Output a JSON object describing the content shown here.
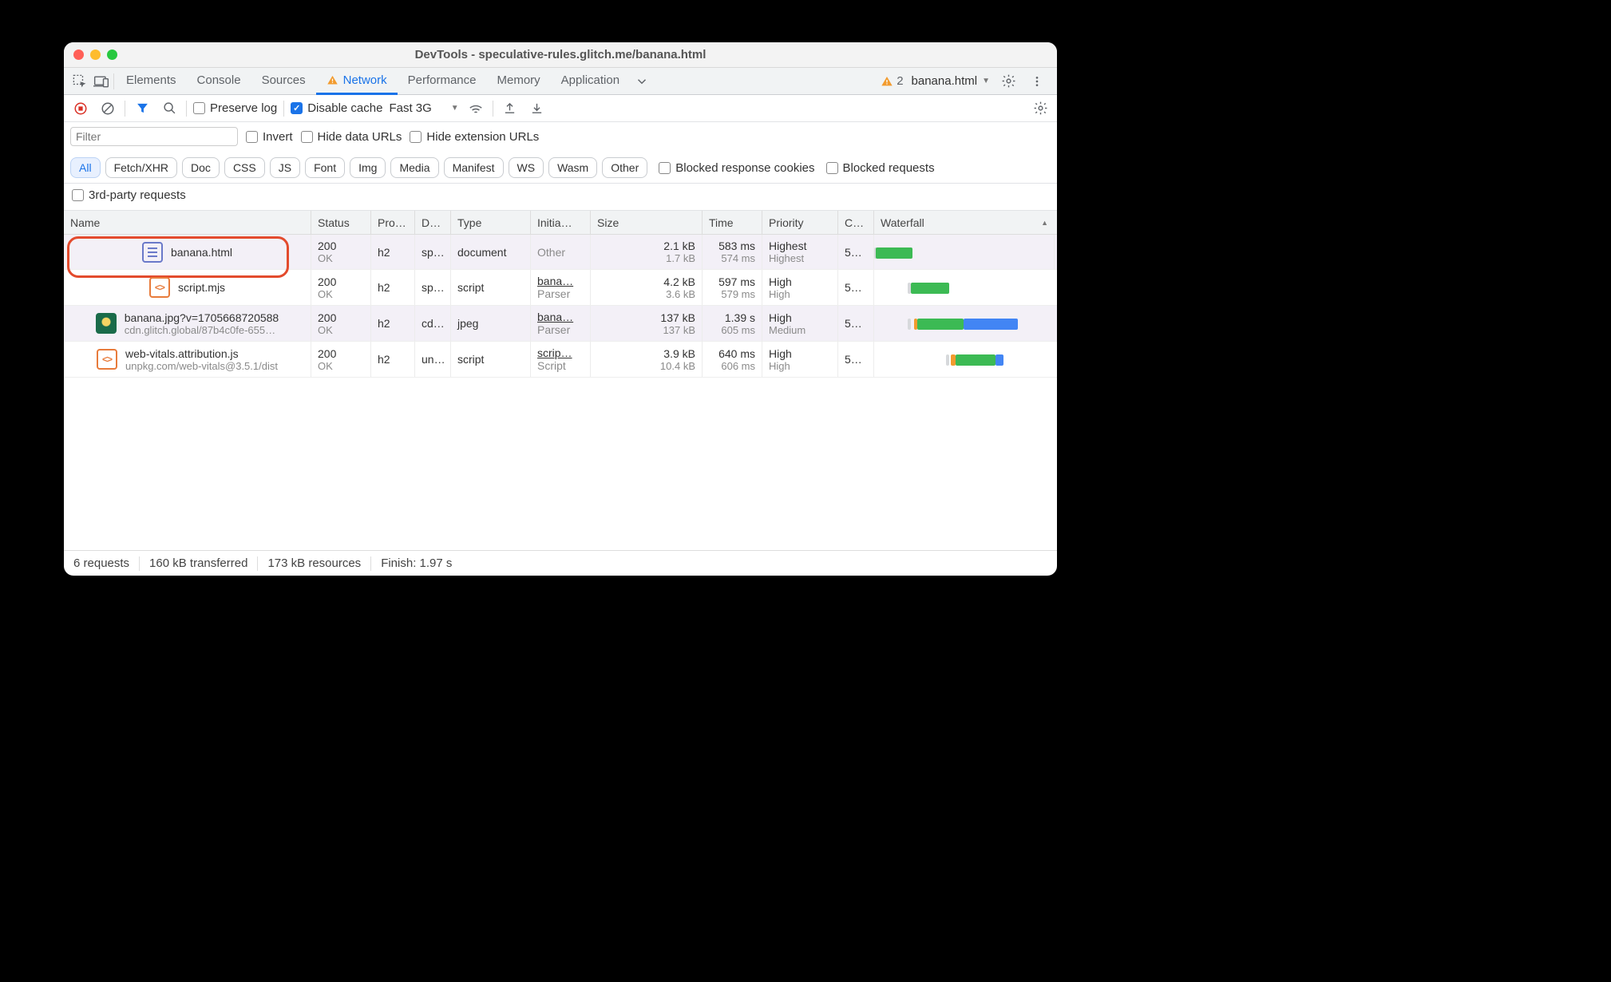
{
  "window": {
    "title": "DevTools - speculative-rules.glitch.me/banana.html"
  },
  "tabs": {
    "items": [
      "Elements",
      "Console",
      "Sources",
      "Network",
      "Performance",
      "Memory",
      "Application"
    ],
    "activeIndex": 3,
    "warningCount": "2",
    "context": "banana.html"
  },
  "toolbar": {
    "preserve_log": "Preserve log",
    "disable_cache": "Disable cache",
    "throttle": "Fast 3G"
  },
  "filters": {
    "placeholder": "Filter",
    "invert": "Invert",
    "hide_data": "Hide data URLs",
    "hide_ext": "Hide extension URLs",
    "types": [
      "All",
      "Fetch/XHR",
      "Doc",
      "CSS",
      "JS",
      "Font",
      "Img",
      "Media",
      "Manifest",
      "WS",
      "Wasm",
      "Other"
    ],
    "blocked_cookies": "Blocked response cookies",
    "blocked_req": "Blocked requests",
    "third_party": "3rd-party requests"
  },
  "columns": [
    "Name",
    "Status",
    "Pro…",
    "D…",
    "Type",
    "Initia…",
    "Size",
    "Time",
    "Priority",
    "C…",
    "Waterfall"
  ],
  "requests": [
    {
      "icon": "doc",
      "name": "banana.html",
      "sub": "",
      "status": "200",
      "status_sub": "OK",
      "proto": "h2",
      "domain": "sp…",
      "type": "document",
      "initiator": "Other",
      "initiator_sub": "",
      "size": "2.1 kB",
      "size_sub": "1.7 kB",
      "time": "583 ms",
      "time_sub": "574 ms",
      "priority": "Highest",
      "priority_sub": "Highest",
      "conn": "5…",
      "wf": {
        "q": 0,
        "start": 2,
        "green": 46,
        "blue": 0,
        "orange": 0
      }
    },
    {
      "icon": "js",
      "name": "script.mjs",
      "sub": "",
      "status": "200",
      "status_sub": "OK",
      "proto": "h2",
      "domain": "sp…",
      "type": "script",
      "initiator": "bana…",
      "initiator_sub": "Parser",
      "size": "4.2 kB",
      "size_sub": "3.6 kB",
      "time": "597 ms",
      "time_sub": "579 ms",
      "priority": "High",
      "priority_sub": "High",
      "conn": "5…",
      "wf": {
        "q": 42,
        "start": 46,
        "green": 48,
        "blue": 0,
        "orange": 0
      }
    },
    {
      "icon": "img",
      "name": "banana.jpg?v=1705668720588",
      "sub": "cdn.glitch.global/87b4c0fe-655…",
      "status": "200",
      "status_sub": "OK",
      "proto": "h2",
      "domain": "cd…",
      "type": "jpeg",
      "initiator": "bana…",
      "initiator_sub": "Parser",
      "size": "137 kB",
      "size_sub": "137 kB",
      "time": "1.39 s",
      "time_sub": "605 ms",
      "priority": "High",
      "priority_sub": "Medium",
      "conn": "5…",
      "wf": {
        "q": 42,
        "start": 50,
        "green": 58,
        "blue": 68,
        "orange": 4
      }
    },
    {
      "icon": "js",
      "name": "web-vitals.attribution.js",
      "sub": "unpkg.com/web-vitals@3.5.1/dist",
      "status": "200",
      "status_sub": "OK",
      "proto": "h2",
      "domain": "un…",
      "type": "script",
      "initiator": "scrip…",
      "initiator_sub": "Script",
      "size": "3.9 kB",
      "size_sub": "10.4 kB",
      "time": "640 ms",
      "time_sub": "606 ms",
      "priority": "High",
      "priority_sub": "High",
      "conn": "5…",
      "wf": {
        "q": 90,
        "start": 96,
        "green": 50,
        "blue": 10,
        "orange": 6
      }
    }
  ],
  "status": {
    "requests": "6 requests",
    "transferred": "160 kB transferred",
    "resources": "173 kB resources",
    "finish": "Finish: 1.97 s"
  }
}
